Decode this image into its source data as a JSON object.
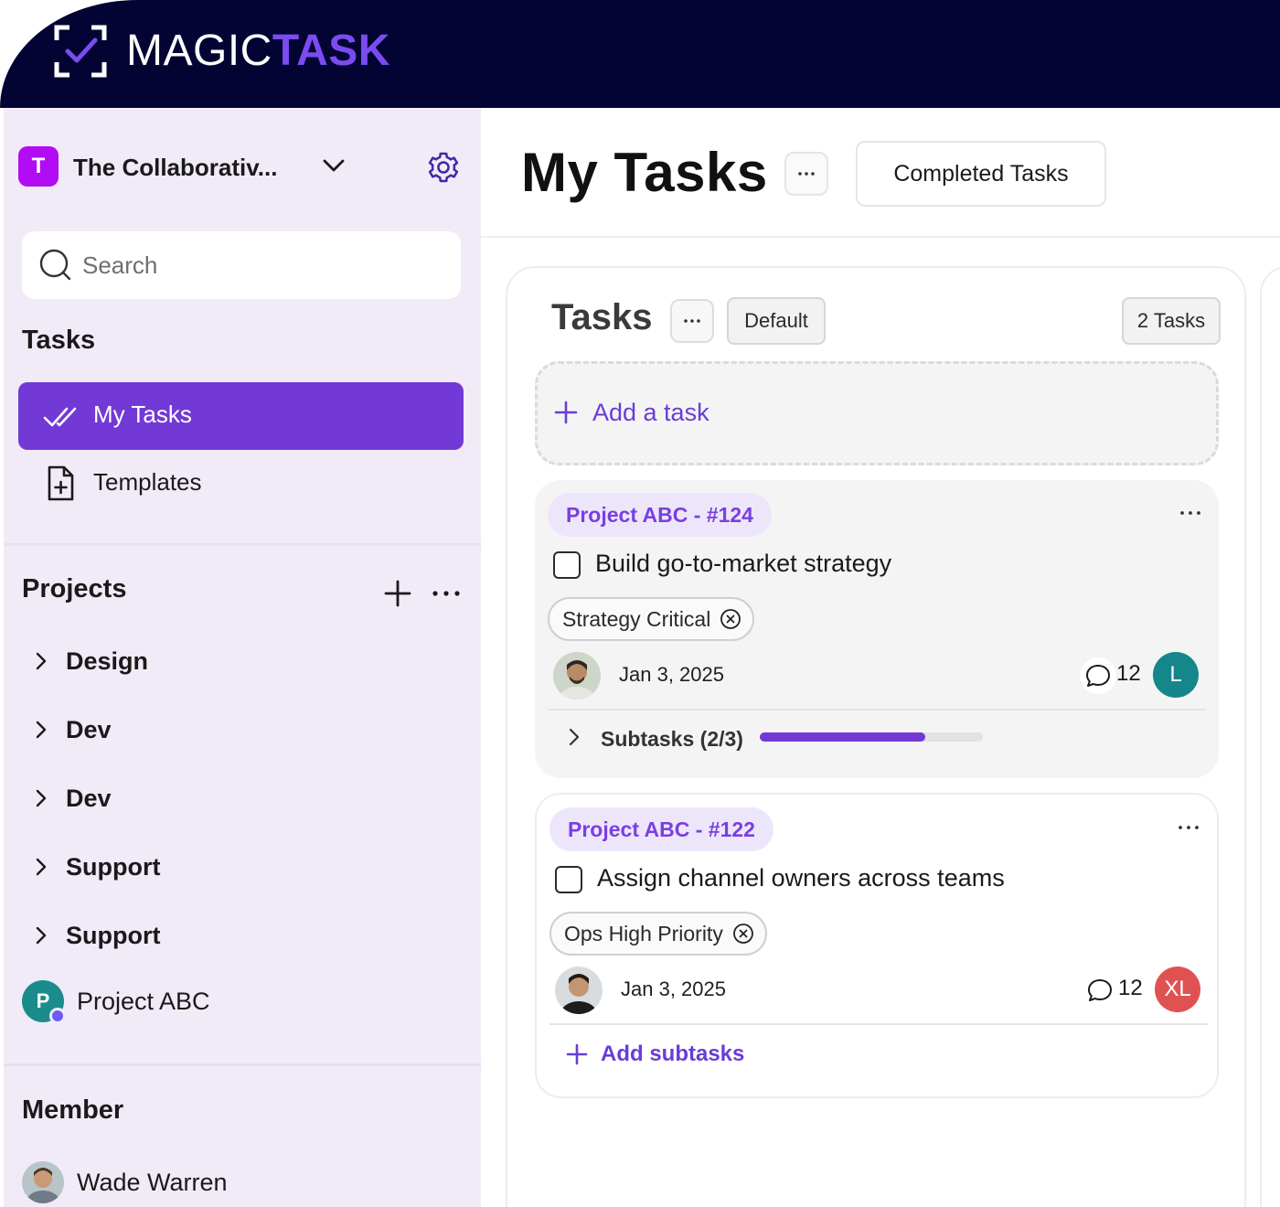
{
  "brand": {
    "magic": "MAGIC",
    "task": "TASK",
    "accent": "#7a4cf0",
    "bar_color": "#030433"
  },
  "sidebar": {
    "workspace": {
      "initial": "T",
      "name": "The Collaborativ...",
      "badge_color": "#b20cf5"
    },
    "search": {
      "placeholder": "Search",
      "value": ""
    },
    "tasks_title": "Tasks",
    "nav": [
      {
        "label": "My Tasks",
        "icon": "double-check-icon",
        "active": true
      },
      {
        "label": "Templates",
        "icon": "file-plus-icon",
        "active": false
      }
    ],
    "projects_title": "Projects",
    "projects": [
      {
        "label": "Design"
      },
      {
        "label": "Dev"
      },
      {
        "label": "Dev"
      },
      {
        "label": "Support"
      },
      {
        "label": "Support"
      }
    ],
    "project_abc": {
      "initial": "P",
      "label": "Project ABC"
    },
    "member_title": "Member",
    "members": [
      {
        "name": "Wade Warren"
      }
    ]
  },
  "header": {
    "title": "My Tasks",
    "more_label": "···",
    "completed_label": "Completed Tasks"
  },
  "board": {
    "column": {
      "title": "Tasks",
      "more_label": "···",
      "view": "Default",
      "count_label": "2 Tasks",
      "add_task_label": "Add a task"
    },
    "cards": [
      {
        "project_tag": "Project ABC - #124",
        "title": "Build go-to-market strategy",
        "checked": false,
        "chip": "Strategy Critical",
        "date": "Jan 3, 2025",
        "comments": "12",
        "assignee_initials": "L",
        "assignee_color": "#15868a",
        "subtasks_label": "Subtasks (2/3)",
        "subtasks_progress": 0.74
      },
      {
        "project_tag": "Project ABC - #122",
        "title": "Assign channel owners across teams",
        "checked": false,
        "chip": "Ops High Priority",
        "date": "Jan 3, 2025",
        "comments": "12",
        "assignee_initials": "XL",
        "assignee_color": "#e05252",
        "add_subtasks_label": "Add subtasks"
      }
    ]
  }
}
